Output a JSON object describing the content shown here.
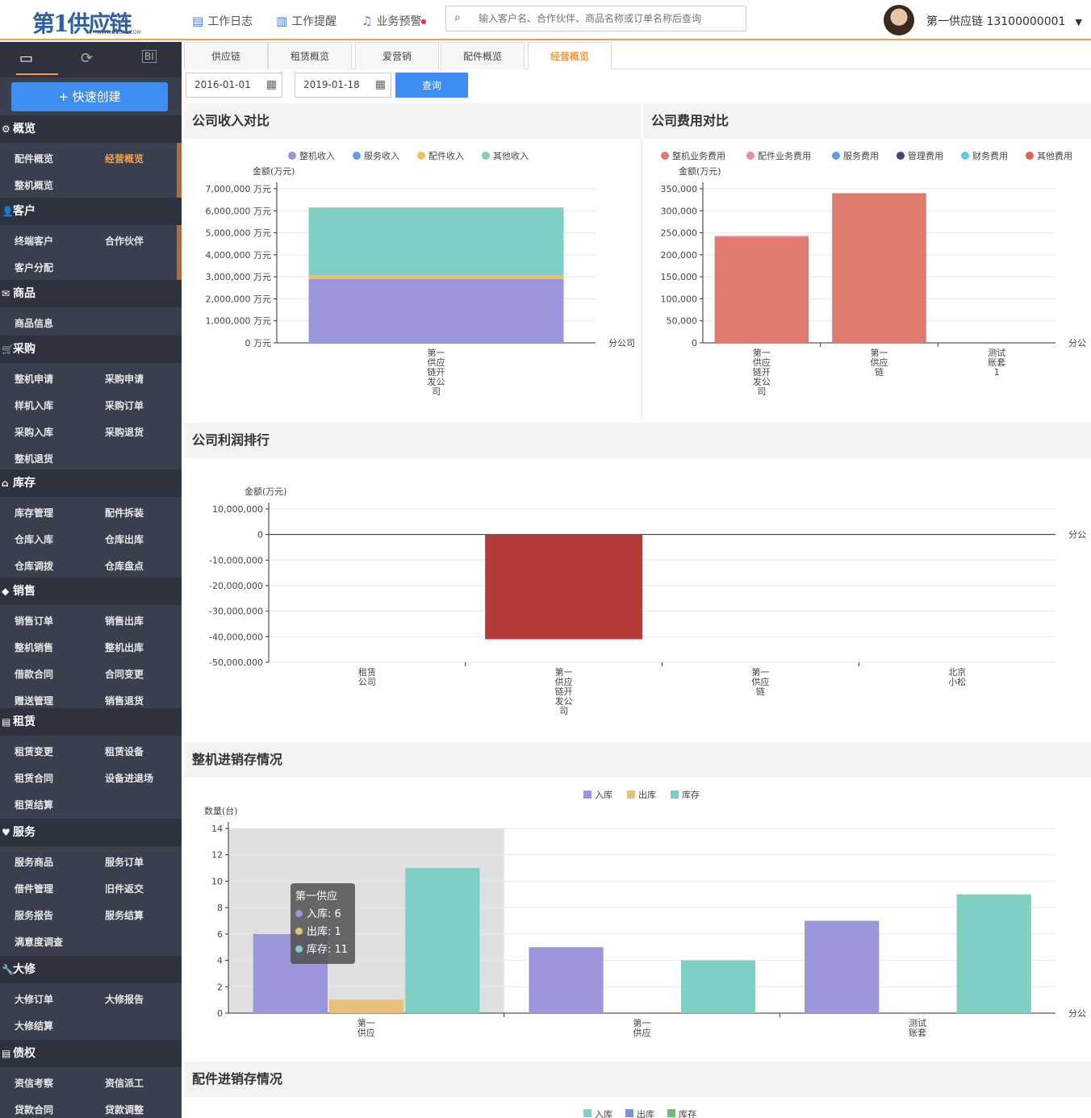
{
  "header": {
    "logo_text": "第1供应链",
    "logo_sub": "WWW.D1GYL.COM",
    "nav": [
      {
        "label": "工作日志",
        "icon": "log-icon"
      },
      {
        "label": "工作提醒",
        "icon": "reminder-icon"
      },
      {
        "label": "业务预警",
        "icon": "bell-icon"
      }
    ],
    "search_placeholder": "输入客户名、合作伙伴、商品名称或订单名称后查询",
    "user": "第一供应链  13100000001"
  },
  "sidebar": {
    "top_icons": [
      "monitor-icon",
      "refresh-icon",
      "bi-icon"
    ],
    "top_bi": "BI",
    "quick_create": "+ 快速创建",
    "sections": [
      {
        "title": "概览",
        "items": [
          "配件概览",
          "经营概览",
          "整机概览"
        ]
      },
      {
        "title": "客户",
        "items": [
          "终端客户",
          "合作伙伴",
          "客户分配"
        ]
      },
      {
        "title": "商品",
        "items": [
          "商品信息"
        ]
      },
      {
        "title": "采购",
        "items": [
          "整机申请",
          "采购申请",
          "样机入库",
          "采购订单",
          "采购入库",
          "采购退货",
          "整机退货"
        ]
      },
      {
        "title": "库存",
        "items": [
          "库存管理",
          "配件拆装",
          "仓库入库",
          "仓库出库",
          "仓库调拨",
          "仓库盘点"
        ]
      },
      {
        "title": "销售",
        "items": [
          "销售订单",
          "销售出库",
          "整机销售",
          "整机出库",
          "借款合同",
          "合同变更",
          "赠送管理",
          "销售退货"
        ]
      },
      {
        "title": "租赁",
        "items": [
          "租赁变更",
          "租赁设备",
          "租赁合同",
          "设备进退场",
          "租赁结算"
        ]
      },
      {
        "title": "服务",
        "items": [
          "服务商品",
          "服务订单",
          "借件管理",
          "旧件返交",
          "服务报告",
          "服务结算",
          "满意度调查"
        ]
      },
      {
        "title": "大修",
        "items": [
          "大修订单",
          "大修报告",
          "大修结算"
        ]
      },
      {
        "title": "债权",
        "items": [
          "资信考察",
          "资信派工",
          "贷款合同",
          "贷款调整"
        ]
      }
    ]
  },
  "tabs": [
    "供应链",
    "租赁概览",
    "爱营销",
    "配件概览",
    "经营概览"
  ],
  "filters": {
    "start": "2016-01-01",
    "end": "2019-01-18",
    "query": "查询"
  },
  "panels": {
    "income": "公司收入对比",
    "expense": "公司费用对比",
    "profit": "公司利润排行",
    "machine": "整机进销存情况",
    "parts": "配件进销存情况"
  },
  "tooltip": {
    "title": "第一供应",
    "rows": [
      "入库: 6",
      "出库: 1",
      "库存: 11"
    ]
  },
  "colors": {
    "accent": "#f0a04a",
    "blue": "#3d8ef0",
    "sidebar": "#3a3f4e"
  },
  "chart_data": [
    {
      "type": "bar",
      "stacked": true,
      "ylabel": "金额(万元)",
      "xlabel": "分公司",
      "ylim": [
        0,
        7000000
      ],
      "categories": [
        "第一供应链开发公司"
      ],
      "series": [
        {
          "name": "整机收入",
          "values": [
            2900000
          ],
          "color": "#9b96dc"
        },
        {
          "name": "服务收入",
          "values": [
            0
          ],
          "color": "#5aa0e8"
        },
        {
          "name": "配件收入",
          "values": [
            150000
          ],
          "color": "#f0c060"
        },
        {
          "name": "其他收入",
          "values": [
            3100000
          ],
          "color": "#7fd0c4"
        }
      ],
      "ticks": [
        "7,000,000 万元",
        "6,000,000 万元",
        "5,000,000 万元",
        "4,000,000 万元",
        "3,000,000 万元",
        "2,000,000 万元",
        "1,000,000 万元",
        "0 万元"
      ]
    },
    {
      "type": "bar",
      "stacked": true,
      "ylabel": "金额(万元)",
      "xlabel": "分公",
      "ylim": [
        0,
        350000
      ],
      "categories": [
        "第一供应链开发公司",
        "第一供应链",
        "测试账套1"
      ],
      "series": [
        {
          "name": "整机业务费用",
          "values": [
            240000,
            340000,
            0
          ],
          "color": "#e07a6e"
        },
        {
          "name": "配件业务费用",
          "values": [
            3000,
            0,
            0
          ],
          "color": "#e888b4"
        },
        {
          "name": "服务费用",
          "values": [
            0,
            0,
            0
          ],
          "color": "#5aa0e8"
        },
        {
          "name": "管理费用",
          "values": [
            0,
            0,
            0
          ],
          "color": "#3b4a78"
        },
        {
          "name": "财务费用",
          "values": [
            0,
            0,
            0
          ],
          "color": "#5cc8e8"
        },
        {
          "name": "其他费用",
          "values": [
            0,
            0,
            0
          ],
          "color": "#e06050"
        }
      ],
      "ticks": [
        "350,000",
        "300,000",
        "250,000",
        "200,000",
        "150,000",
        "100,000",
        "50,000",
        "0"
      ]
    },
    {
      "type": "bar",
      "ylabel": "金额(万元)",
      "xlabel": "分公",
      "ylim": [
        -50000000,
        10000000
      ],
      "categories": [
        "租赁公司",
        "第一供应链开发公司",
        "第一供应链",
        "北京小松"
      ],
      "series": [
        {
          "name": "利润",
          "values": [
            0,
            -41000000,
            0,
            0
          ],
          "color": "#b33c38"
        }
      ],
      "ticks": [
        "10,000,000",
        "0",
        "-10,000,000",
        "-20,000,000",
        "-30,000,000",
        "-40,000,000",
        "-50,000,000"
      ]
    },
    {
      "type": "bar",
      "ylabel": "数量(台)",
      "xlabel": "分公",
      "ylim": [
        0,
        14
      ],
      "categories": [
        "第一供应",
        "第一供应",
        "测试账套"
      ],
      "series": [
        {
          "name": "入库",
          "values": [
            6,
            5,
            7
          ],
          "color": "#9b96dc"
        },
        {
          "name": "出库",
          "values": [
            1,
            0,
            0
          ],
          "color": "#e8c07a"
        },
        {
          "name": "库存",
          "values": [
            11,
            4,
            9
          ],
          "color": "#7fd0c4"
        }
      ],
      "ticks": [
        "14",
        "12",
        "10",
        "8",
        "6",
        "4",
        "2",
        "0"
      ]
    },
    {
      "type": "bar",
      "legend": [
        "入库",
        "出库",
        "库存"
      ],
      "colors": [
        "#7fd0c4",
        "#7a90e0",
        "#6cc070"
      ]
    }
  ]
}
